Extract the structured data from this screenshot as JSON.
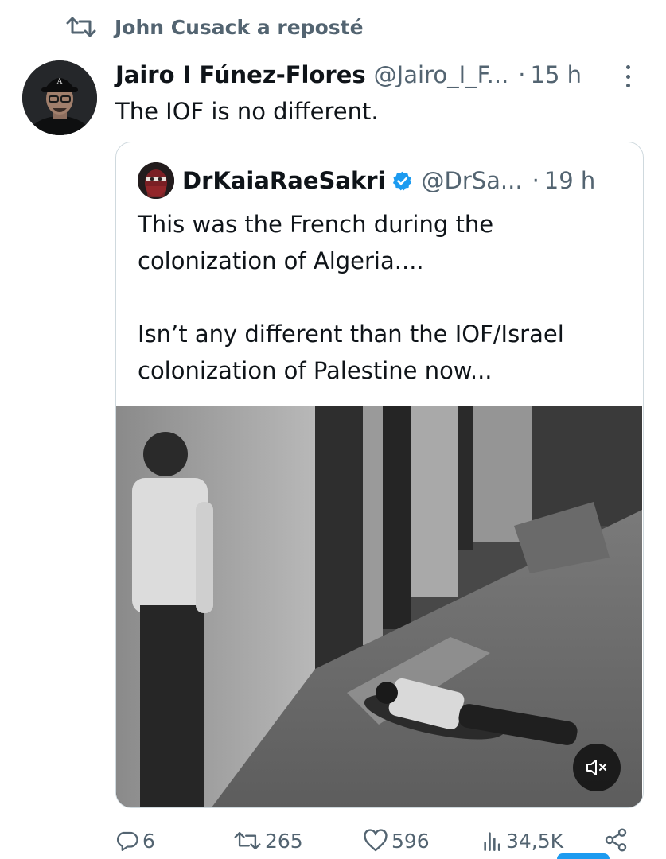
{
  "repost": {
    "text": "John Cusack a reposté",
    "icon": "repost-icon"
  },
  "post": {
    "author_name": "Jairo I Fúnez-Flores",
    "author_handle": "@Jairo_I_F...",
    "separator": "·",
    "time": "15 h",
    "text": "The IOF is no different."
  },
  "quote": {
    "author_name": "DrKaiaRaeSakri",
    "verified": true,
    "author_handle": "@DrSa...",
    "separator": "·",
    "time": "19 h",
    "text": "This was the French during the\ncolonization of Algeria....\n\nIsn’t any different than the IOF/Israel\ncolonization of Palestine now...",
    "media": {
      "type": "video",
      "muted": true,
      "icon": "mute-icon"
    }
  },
  "actions": {
    "replies": "6",
    "reposts": "265",
    "likes": "596",
    "views": "34,5K"
  },
  "colors": {
    "text": "#0f1419",
    "secondary": "#536471",
    "border": "#cfd9de",
    "accent": "#1d9bf0"
  }
}
